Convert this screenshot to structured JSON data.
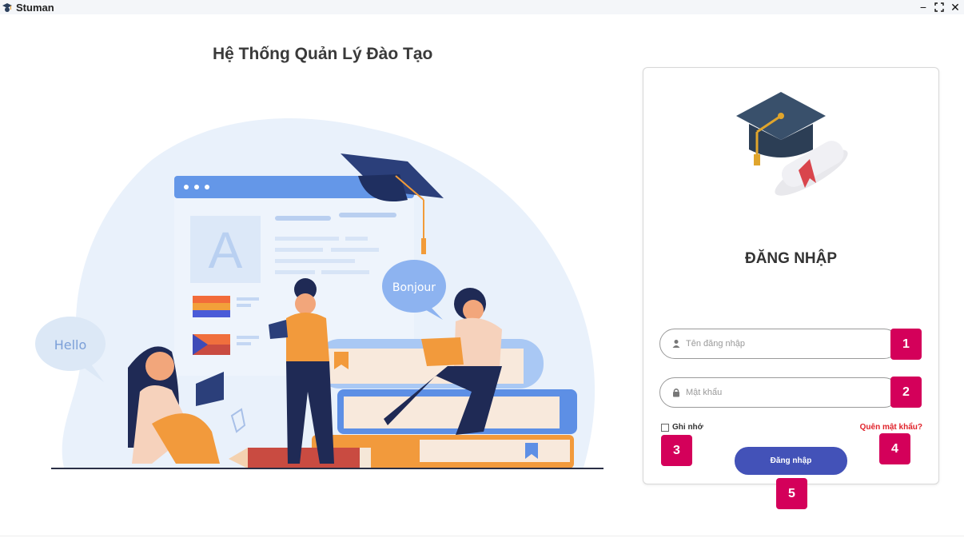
{
  "window": {
    "title": "Stuman",
    "icon": "student-cap-icon",
    "controls": {
      "minimize": "−",
      "maximize": "⛶",
      "close": "✕"
    }
  },
  "heading": "Hệ Thống Quản Lý Đào Tạo",
  "illustration": {
    "bubble_left": "Hello",
    "bubble_right": "Bonjour",
    "book_letter": "A"
  },
  "login": {
    "title": "ĐĂNG NHẬP",
    "username_placeholder": "Tên đăng nhập",
    "password_placeholder": "Mật khẩu",
    "remember_label": "Ghi nhớ",
    "forgot_label": "Quên mật khẩu?",
    "submit_label": "Đăng nhập"
  },
  "markers": [
    "1",
    "2",
    "3",
    "4",
    "5"
  ],
  "colors": {
    "accent": "#4352b8",
    "marker": "#d4005a",
    "forgot": "#e0222a"
  }
}
